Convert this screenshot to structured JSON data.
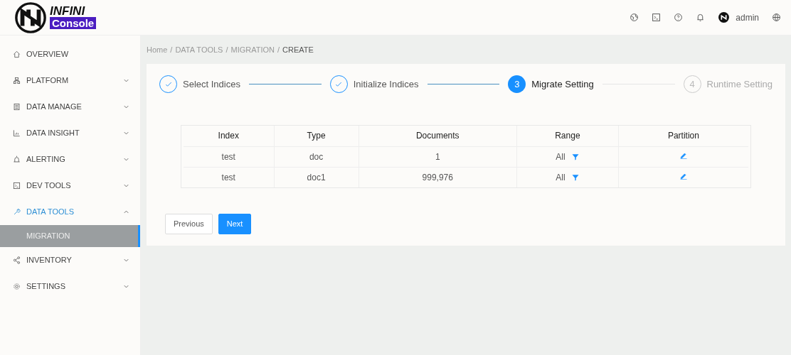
{
  "header": {
    "logo_top": "INFINI",
    "logo_bottom": "Console",
    "user": "admin"
  },
  "breadcrumb": [
    {
      "label": "Home"
    },
    {
      "separator": "/",
      "label": "DATA TOOLS"
    },
    {
      "separator": "/",
      "label": "MIGRATION"
    },
    {
      "separator": "/",
      "label": "CREATE"
    }
  ],
  "sidebar": {
    "items": [
      {
        "label": "OVERVIEW",
        "selected": false
      },
      {
        "label": "PLATFORM",
        "expanded": false,
        "selected": false
      },
      {
        "label": "DATA MANAGE",
        "expanded": false,
        "selected": false
      },
      {
        "label": "DATA INSIGHT",
        "expanded": false,
        "selected": false
      },
      {
        "label": "ALERTING",
        "expanded": false,
        "selected": false
      },
      {
        "label": "DEV TOOLS",
        "expanded": false,
        "selected": false
      },
      {
        "label": "DATA TOOLS",
        "expanded": true,
        "selected": true,
        "children": [
          {
            "label": "MIGRATION",
            "selected": true
          }
        ]
      },
      {
        "label": "INVENTORY",
        "expanded": false,
        "selected": false
      },
      {
        "label": "SETTINGS",
        "expanded": false,
        "selected": false
      }
    ]
  },
  "steps": [
    {
      "label": "Select Indices",
      "finished": true,
      "selected": false
    },
    {
      "label": "Initialize Indices",
      "finished": true,
      "selected": false
    },
    {
      "number": "3",
      "label": "Migrate Setting",
      "finished": false,
      "selected": true
    },
    {
      "number": "4",
      "label": "Runtime Setting",
      "finished": false,
      "selected": false
    }
  ],
  "table": {
    "columns": [
      "Index",
      "Type",
      "Documents",
      "Range",
      "Partition"
    ],
    "rows": [
      {
        "index": "test",
        "type": "doc",
        "documents": "1",
        "range": "All"
      },
      {
        "index": "test",
        "type": "doc1",
        "documents": "999,976",
        "range": "All"
      }
    ]
  },
  "buttons": [
    {
      "label": "Previous",
      "kind": "default"
    },
    {
      "label": "Next",
      "kind": "primary"
    }
  ]
}
